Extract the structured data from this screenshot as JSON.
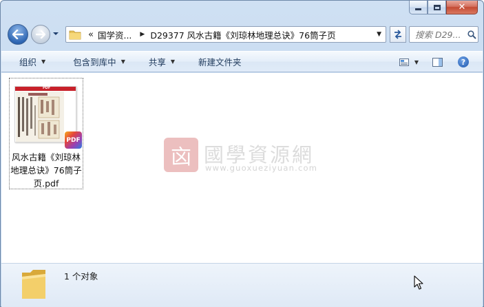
{
  "window": {
    "caption_buttons": {
      "minimize": "minimize-icon",
      "maximize": "maximize-icon",
      "close": "close-icon"
    }
  },
  "nav": {
    "address": {
      "overflow": "«",
      "crumbs": [
        "国学资...",
        "D29377 风水古籍《刘琼林地理总诀》76筒子页"
      ]
    },
    "search_placeholder": "搜索 D29..."
  },
  "toolbar": {
    "organize": "组织",
    "include_in_library": "包含到库中",
    "share": "共享",
    "new_folder": "新建文件夹"
  },
  "content": {
    "files": [
      {
        "name": "风水古籍《刘琼林地理总诀》76筒子页.pdf",
        "badge": "PDF",
        "thumb_header": "PDF"
      }
    ],
    "watermark": {
      "seal": "㐫",
      "title": "國學資源網",
      "url": "www.guoxueziyuan.com"
    }
  },
  "status": {
    "count_text": "1 个对象"
  },
  "colors": {
    "accent": "#1e395b",
    "pdf_red": "#c8212a",
    "watermark": "#dcdcdc"
  }
}
